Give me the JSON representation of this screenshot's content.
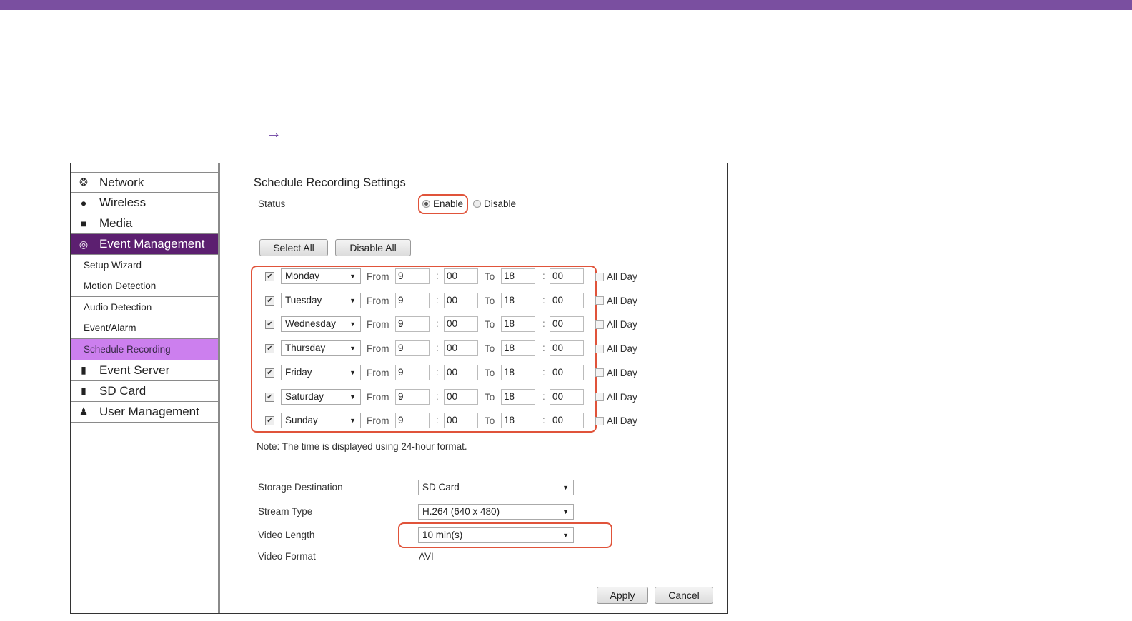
{
  "nav": {
    "items": [
      {
        "label": "Network",
        "icon": "globe-icon",
        "glyph": "❂"
      },
      {
        "label": "Wireless",
        "icon": "wireless-icon",
        "glyph": "⦁"
      },
      {
        "label": "Media",
        "icon": "media-icon",
        "glyph": "■"
      },
      {
        "label": "Event Management",
        "icon": "event-management-icon",
        "glyph": "◎",
        "active": true
      }
    ],
    "subitems": [
      {
        "label": "Setup Wizard"
      },
      {
        "label": "Motion Detection"
      },
      {
        "label": "Audio Detection"
      },
      {
        "label": "Event/Alarm"
      },
      {
        "label": "Schedule Recording",
        "active": true
      }
    ],
    "bottom_items": [
      {
        "label": "Event Server",
        "icon": "event-server-icon",
        "glyph": "▮"
      },
      {
        "label": "SD Card",
        "icon": "sd-card-icon",
        "glyph": "▮"
      },
      {
        "label": "User Management",
        "icon": "users-icon",
        "glyph": "♟"
      }
    ]
  },
  "page": {
    "title": "Schedule Recording Settings",
    "status_label": "Status",
    "enable_label": "Enable",
    "disable_label": "Disable",
    "select_all": "Select All",
    "disable_all": "Disable All",
    "from_label": "From",
    "to_label": "To",
    "all_day_label": "All Day",
    "note": "Note: The time is displayed using 24-hour format.",
    "storage_label": "Storage Destination",
    "storage_value": "SD Card",
    "stream_label": "Stream Type",
    "stream_value": "H.264 (640 x 480)",
    "length_label": "Video Length",
    "length_value": "10 min(s)",
    "format_label": "Video Format",
    "format_value": "AVI",
    "apply": "Apply",
    "cancel": "Cancel"
  },
  "schedule": [
    {
      "day": "Monday",
      "from_h": "9",
      "from_m": "00",
      "to_h": "18",
      "to_m": "00",
      "checked": true,
      "all_day": false
    },
    {
      "day": "Tuesday",
      "from_h": "9",
      "from_m": "00",
      "to_h": "18",
      "to_m": "00",
      "checked": true,
      "all_day": false
    },
    {
      "day": "Wednesday",
      "from_h": "9",
      "from_m": "00",
      "to_h": "18",
      "to_m": "00",
      "checked": true,
      "all_day": false
    },
    {
      "day": "Thursday",
      "from_h": "9",
      "from_m": "00",
      "to_h": "18",
      "to_m": "00",
      "checked": true,
      "all_day": false
    },
    {
      "day": "Friday",
      "from_h": "9",
      "from_m": "00",
      "to_h": "18",
      "to_m": "00",
      "checked": true,
      "all_day": false
    },
    {
      "day": "Saturday",
      "from_h": "9",
      "from_m": "00",
      "to_h": "18",
      "to_m": "00",
      "checked": true,
      "all_day": false
    },
    {
      "day": "Sunday",
      "from_h": "9",
      "from_m": "00",
      "to_h": "18",
      "to_m": "00",
      "checked": true,
      "all_day": false
    }
  ],
  "colors": {
    "topbar": "#7a4fa0",
    "nav_active": "#5c1f70",
    "sub_active": "#cc7fee",
    "highlight": "#e0533a",
    "arrow": "#6b3fa0"
  },
  "arrow_glyph": "→"
}
